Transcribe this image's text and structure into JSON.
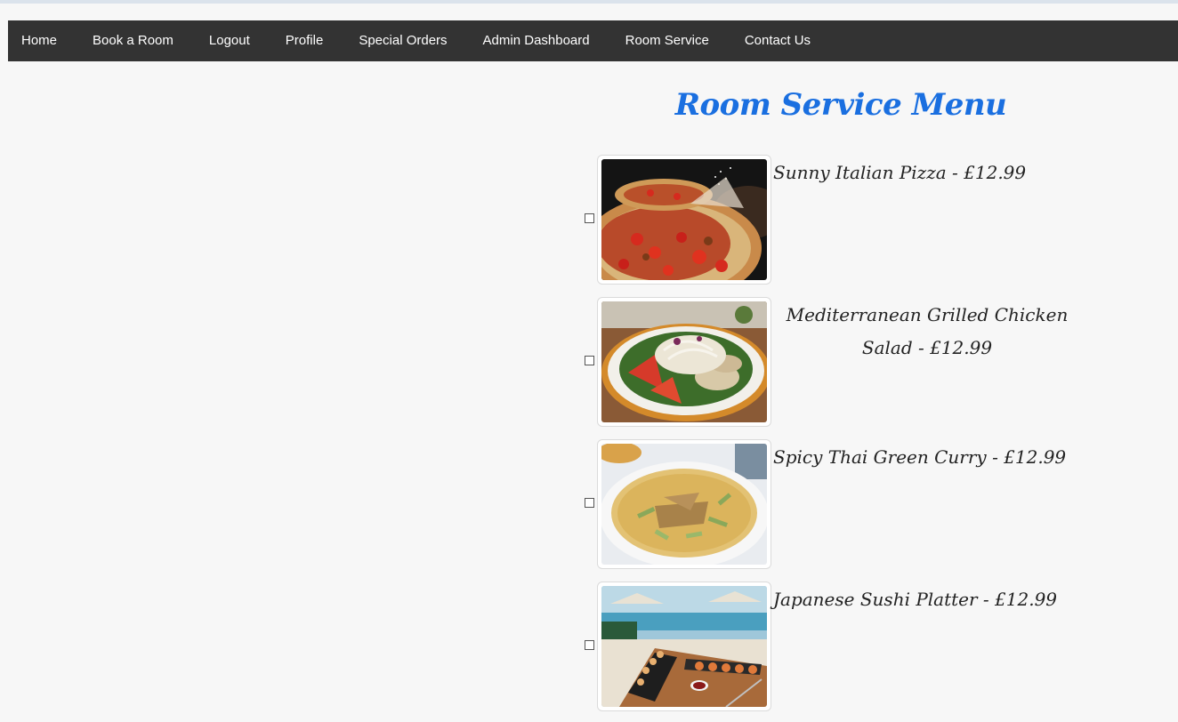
{
  "nav": {
    "items": [
      {
        "label": "Home",
        "name": "nav-home"
      },
      {
        "label": "Book a Room",
        "name": "nav-book-a-room"
      },
      {
        "label": "Logout",
        "name": "nav-logout"
      },
      {
        "label": "Profile",
        "name": "nav-profile"
      },
      {
        "label": "Special Orders",
        "name": "nav-special-orders"
      },
      {
        "label": "Admin Dashboard",
        "name": "nav-admin-dashboard"
      },
      {
        "label": "Room Service",
        "name": "nav-room-service"
      },
      {
        "label": "Contact Us",
        "name": "nav-contact-us"
      }
    ]
  },
  "page": {
    "title": "Room Service Menu"
  },
  "menu": {
    "items": [
      {
        "name": "Sunny Italian Pizza",
        "price": "£12.99",
        "label": "Sunny Italian Pizza - £12.99",
        "checked": false,
        "image": "pizza-photo"
      },
      {
        "name": "Mediterranean Grilled Chicken Salad",
        "price": "£12.99",
        "label": "Mediterranean Grilled Chicken Salad - £12.99",
        "checked": false,
        "image": "salad-photo"
      },
      {
        "name": "Spicy Thai Green Curry",
        "price": "£12.99",
        "label": "Spicy Thai Green Curry - £12.99",
        "checked": false,
        "image": "curry-photo"
      },
      {
        "name": "Japanese Sushi Platter",
        "price": "£12.99",
        "label": "Japanese Sushi Platter - £12.99",
        "checked": false,
        "image": "sushi-photo"
      }
    ]
  },
  "colors": {
    "navbar_bg": "#333333",
    "title": "#1a6fe0",
    "page_bg": "#f7f7f7"
  }
}
